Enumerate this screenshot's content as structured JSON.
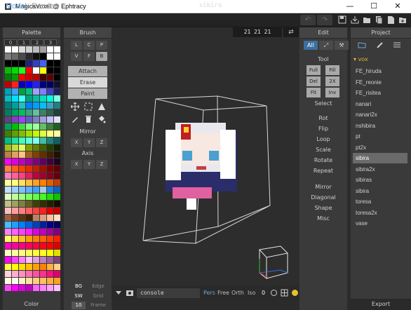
{
  "window": {
    "title": "MagicaVoxel @ Ephtracy",
    "minimize": "—",
    "maximize": "☐",
    "close": "✕"
  },
  "toolbar": {
    "mode_model": "Model",
    "mode_render": "Render",
    "project_name": "sibira",
    "undo": "↶",
    "redo": "↷",
    "icons": [
      "save-icon",
      "export-icon",
      "open-folder-icon",
      "copy-icon",
      "new-file-icon",
      "new-folder-icon"
    ]
  },
  "palette": {
    "title": "Palette",
    "tabs": [
      "0",
      "1",
      "2",
      "3"
    ],
    "footer": "Color",
    "colors": [
      "#ffffff",
      "#ffffff",
      "#dcdcdc",
      "#cfcfcf",
      "#bdbdbd",
      "#a0a0a0",
      "#ffffff",
      "#ffffff",
      "#808080",
      "#6a6a6a",
      "#4a4a4a",
      "#2a2a2a",
      "#101010",
      "#000000",
      "#ffffff",
      "#ffffff",
      "#000000",
      "#000000",
      "#000000",
      "#202080",
      "#3040c0",
      "#4060ff",
      "#000000",
      "#000000",
      "#00c000",
      "#00e000",
      "#20ff20",
      "#ff0000",
      "#ffffff",
      "#ffff00",
      "#000000",
      "#000000",
      "#008000",
      "#00a000",
      "#ff0000",
      "#d00000",
      "#c00000",
      "#400000",
      "#600000",
      "#000000",
      "#c00000",
      "#ff2020",
      "#0000c0",
      "#0000ff",
      "#2020ff",
      "#000080",
      "#000060",
      "#101030",
      "#00a0c0",
      "#40a0ff",
      "#00a040",
      "#00c080",
      "#a0a0ff",
      "#8080ff",
      "#4040c0",
      "#202060",
      "#00c0c0",
      "#00e0ff",
      "#40ffff",
      "#00a080",
      "#00c0a0",
      "#00e0c0",
      "#00ffe0",
      "#80ffe0",
      "#008080",
      "#00a0a0",
      "#20c0c0",
      "#0080ff",
      "#00a0ff",
      "#00c0ff",
      "#40a0c0",
      "#208080",
      "#008060",
      "#00a060",
      "#00c060",
      "#40a080",
      "#60c0a0",
      "#408060",
      "#306050",
      "#204040",
      "#604080",
      "#8040c0",
      "#a040ff",
      "#6060c0",
      "#8080c0",
      "#a0a0e0",
      "#c0c0ff",
      "#e0e0ff",
      "#00a060",
      "#00c000",
      "#40e040",
      "#80ff80",
      "#a0ffa0",
      "#60c060",
      "#408040",
      "#206020",
      "#408000",
      "#60a000",
      "#80c000",
      "#a0e000",
      "#c0ff00",
      "#e0ff40",
      "#ffff80",
      "#ffffa0",
      "#00c080",
      "#20e0a0",
      "#40ffc0",
      "#60ffe0",
      "#80fff0",
      "#40c0a0",
      "#208080",
      "#106060",
      "#a0c020",
      "#c0e040",
      "#e0ff60",
      "#80a000",
      "#608000",
      "#406000",
      "#204000",
      "#102000",
      "#c08040",
      "#e0a060",
      "#ffc080",
      "#a06020",
      "#804000",
      "#603000",
      "#402000",
      "#201000",
      "#ff00ff",
      "#e000e0",
      "#c000c0",
      "#a000a0",
      "#800080",
      "#600060",
      "#400040",
      "#200020",
      "#ff8040",
      "#ff6020",
      "#ff4000",
      "#e03000",
      "#c02000",
      "#a01000",
      "#800000",
      "#600000",
      "#ff80c0",
      "#ff60a0",
      "#ff4080",
      "#e02060",
      "#c00040",
      "#a00030",
      "#800020",
      "#600010",
      "#ffffa0",
      "#ffff80",
      "#ffe060",
      "#ffc040",
      "#ffa020",
      "#ff8000",
      "#e06000",
      "#c04000",
      "#c0e0ff",
      "#a0d0ff",
      "#80c0ff",
      "#60b0ff",
      "#40a0ff",
      "#a6c8e8",
      "#2080e0",
      "#1060c0",
      "#e0ffc0",
      "#c0ffa0",
      "#a0ff80",
      "#80ff60",
      "#60ff40",
      "#40ff20",
      "#20e000",
      "#10c000",
      "#c0c080",
      "#a0a060",
      "#808040",
      "#606020",
      "#404000",
      "#303000",
      "#202000",
      "#101000",
      "#ffc0c0",
      "#ffa0a0",
      "#ff8080",
      "#ff6060",
      "#ff4040",
      "#ff2020",
      "#e00000",
      "#c00000",
      "#a06040",
      "#804020",
      "#603010",
      "#402000",
      "#c08060",
      "#e0a080",
      "#ffc0a0",
      "#ffe0c0",
      "#40c0ff",
      "#20a0ff",
      "#0080ff",
      "#0060e0",
      "#0040c0",
      "#0020a0",
      "#000080",
      "#000060",
      "#ff80ff",
      "#ff60ff",
      "#ff40ff",
      "#ff20ff",
      "#e000e0",
      "#c000c0",
      "#a000a0",
      "#800080",
      "#ffff60",
      "#ffe040",
      "#ffc020",
      "#ffa000",
      "#ff8000",
      "#ff6000",
      "#ff4000",
      "#ff2000",
      "#ff00c0",
      "#ff00a0",
      "#ff0080",
      "#ff0060",
      "#ff0040",
      "#ff0020",
      "#ff0000",
      "#e00000",
      "#ffffc0",
      "#ffffa0",
      "#ffff80",
      "#ffff60",
      "#ffff40",
      "#ffff20",
      "#ffff00",
      "#e0e000",
      "#ff00ff",
      "#ff40ff",
      "#ff80ff",
      "#ffc0ff",
      "#e0a0e0",
      "#c080c0",
      "#a060a0",
      "#804080",
      "#ffff40",
      "#ffff00",
      "#ffe000",
      "#ffc000",
      "#ffa000",
      "#ff8000",
      "#ffb040",
      "#ffd080",
      "#ffd0e0",
      "#ffb0d0",
      "#ff90c0",
      "#ff70b0",
      "#ff50a0",
      "#ff3090",
      "#ff1080",
      "#e00070",
      "#ffffe0",
      "#fffff0",
      "#fff0c0",
      "#ffe0a0",
      "#ffd080",
      "#ffc060",
      "#ffb040",
      "#ffa020",
      "#ff40ff",
      "#ff00ff",
      "#e000e0",
      "#c000c0",
      "#ff60ff",
      "#ff80ff",
      "#ffa0ff",
      "#ffc0ff"
    ]
  },
  "brush": {
    "title": "Brush",
    "shapes": [
      "L",
      "C",
      "P",
      "V",
      "F",
      "B"
    ],
    "actions": [
      "Attach",
      "Erase",
      "Paint"
    ],
    "tools": [
      "move-icon",
      "select-box-icon",
      "cone-icon",
      "pencil-icon",
      "trash-icon",
      "bucket-icon"
    ],
    "mirror_label": "Mirror",
    "mirror": [
      "X",
      "Y",
      "Z"
    ],
    "axis_label": "Axis",
    "axis": [
      "X",
      "Y",
      "Z"
    ],
    "bottom": {
      "bg": "BG",
      "edge": "Edge",
      "sw": "SW",
      "grid": "Grid",
      "size": "10",
      "frame": "Frame"
    }
  },
  "viewport": {
    "dims": "21 21 21",
    "swap": "⇄"
  },
  "console": {
    "text": "console",
    "cam": [
      "Pers",
      "Free",
      "Orth",
      "Iso"
    ],
    "zero": "0"
  },
  "edit": {
    "title": "Edit",
    "tabs": [
      "All",
      "⤢",
      "⚒"
    ],
    "tool_label": "Tool",
    "grid": [
      "Full",
      "Fill",
      "Del",
      "2X",
      "Fit",
      "Inv"
    ],
    "select": "Select",
    "ops": [
      "Rot",
      "Flip",
      "Loop",
      "Scale",
      "Rotate",
      "Repeat"
    ],
    "ops2": [
      "Mirror",
      "Diagonal",
      "Shape",
      "Misc"
    ]
  },
  "project": {
    "title": "Project",
    "folder": "vox",
    "items": [
      "FE_hiruda",
      "FE_reonie",
      "FE_risitea",
      "nanari",
      "nanari2x",
      "nshibira",
      "pt",
      "pt2x",
      "sibira",
      "sibira2x",
      "sibiras",
      "sibira",
      "toresa",
      "toresa2x",
      "vase"
    ],
    "selected_index": 8,
    "export": "Export"
  }
}
